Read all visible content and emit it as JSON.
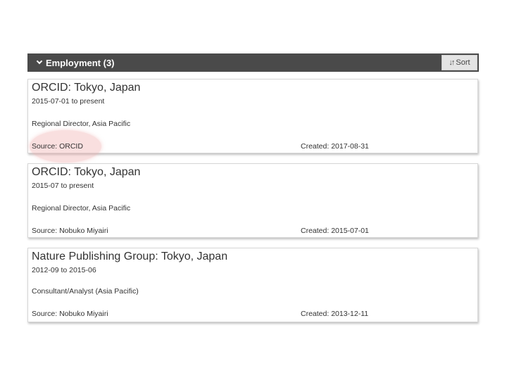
{
  "section": {
    "title": "Employment (3)",
    "sort_label": "Sort"
  },
  "cards": [
    {
      "title": "ORCID: Tokyo, Japan",
      "dates": "2015-07-01 to present",
      "role": "Regional Director, Asia Pacific",
      "source": "Source: ORCID",
      "created": "Created: 2017-08-31"
    },
    {
      "title": "ORCID: Tokyo, Japan",
      "dates": "2015-07 to present",
      "role": "Regional Director, Asia Pacific",
      "source": "Source: Nobuko Miyairi",
      "created": "Created: 2015-07-01"
    },
    {
      "title": "Nature Publishing Group: Tokyo, Japan",
      "dates": "2012-09 to 2015-06",
      "role": "Consultant/Analyst (Asia Pacific)",
      "source": "Source: Nobuko Miyairi",
      "created": "Created: 2013-12-11"
    }
  ],
  "icons": {
    "section_toggle": "chevron-down-icon",
    "sort": "sort-arrows-icon"
  },
  "colors": {
    "header_bg": "#4a4a4a",
    "highlight": "#f0aaaa"
  }
}
